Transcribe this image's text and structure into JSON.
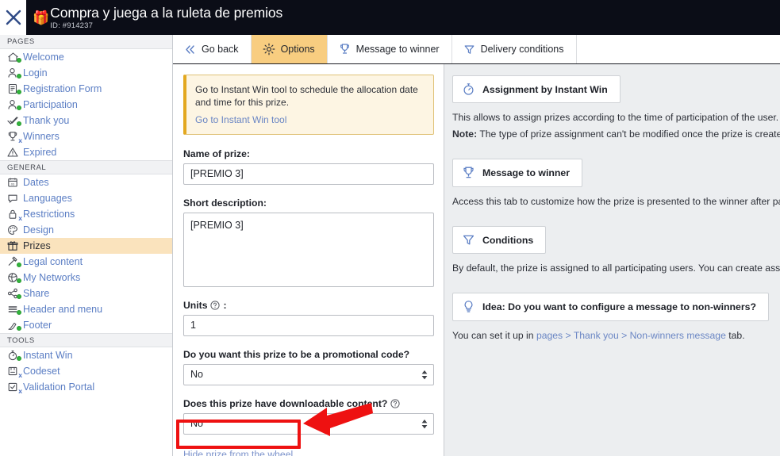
{
  "topbar": {
    "close_icon": "close-icon",
    "gift_icon": "🎁",
    "title": "Compra y juega a la ruleta de premios",
    "id": "ID: #914237"
  },
  "sidebar": {
    "sections": [
      {
        "label": "PAGES",
        "items": [
          {
            "label": "Welcome",
            "icon": "home-icon",
            "status": "on"
          },
          {
            "label": "Login",
            "icon": "user-icon",
            "status": "on"
          },
          {
            "label": "Registration Form",
            "icon": "form-icon",
            "status": "on"
          },
          {
            "label": "Participation",
            "icon": "user-check-icon",
            "status": "on"
          },
          {
            "label": "Thank you",
            "icon": "check-icon",
            "status": "on"
          },
          {
            "label": "Winners",
            "icon": "trophy-icon",
            "status": "off"
          },
          {
            "label": "Expired",
            "icon": "warning-icon",
            "status": "none"
          }
        ]
      },
      {
        "label": "GENERAL",
        "items": [
          {
            "label": "Dates",
            "icon": "calendar-icon",
            "status": "none"
          },
          {
            "label": "Languages",
            "icon": "speech-bubble-icon",
            "status": "none"
          },
          {
            "label": "Restrictions",
            "icon": "lock-icon",
            "status": "off"
          },
          {
            "label": "Design",
            "icon": "palette-icon",
            "status": "none"
          },
          {
            "label": "Prizes",
            "icon": "gift-icon",
            "status": "none",
            "active": true
          },
          {
            "label": "Legal content",
            "icon": "gavel-icon",
            "status": "on"
          },
          {
            "label": "My Networks",
            "icon": "network-icon",
            "status": "on"
          },
          {
            "label": "Share",
            "icon": "share-icon",
            "status": "on"
          },
          {
            "label": "Header and menu",
            "icon": "menu-icon",
            "status": "on"
          },
          {
            "label": "Footer",
            "icon": "footer-icon",
            "status": "on"
          }
        ]
      },
      {
        "label": "TOOLS",
        "items": [
          {
            "label": "Instant Win",
            "icon": "stopwatch-icon",
            "status": "on"
          },
          {
            "label": "Codeset",
            "icon": "codeset-icon",
            "status": "off"
          },
          {
            "label": "Validation Portal",
            "icon": "validation-icon",
            "status": "off"
          }
        ]
      }
    ]
  },
  "tabs": [
    {
      "label": "Go back",
      "icon": "chevron-double-left-icon",
      "active": false
    },
    {
      "label": "Options",
      "icon": "gear-icon",
      "active": true
    },
    {
      "label": "Message to winner",
      "icon": "trophy-icon",
      "active": false
    },
    {
      "label": "Delivery conditions",
      "icon": "funnel-icon",
      "active": false
    }
  ],
  "form": {
    "notice": {
      "text": "Go to Instant Win tool to schedule the allocation date and time for this prize.",
      "link": "Go to Instant Win tool"
    },
    "name_label": "Name of prize:",
    "name_value": "[PREMIO 3]",
    "description_label": "Short description:",
    "description_value": "[PREMIO 3]",
    "units_label": "Units",
    "units_suffix": ":",
    "units_value": "1",
    "promo_label": "Do you want this prize to be a promotional code?",
    "promo_value": "No",
    "downloadable_label": "Does this prize have downloadable content?",
    "downloadable_value": "No",
    "hide_link": "Hide prize from the wheel"
  },
  "info": {
    "card_assignment": "Assignment by Instant Win",
    "assignment_text": "This allows to assign prizes according to the time of participation of the user. The",
    "note_prefix": "Note:",
    "note_text": "The type of prize assignment can't be modified once the prize is created.",
    "card_message": "Message to winner",
    "message_text": "Access this tab to customize how the prize is presented to the winner after parti",
    "card_conditions": "Conditions",
    "conditions_text": "By default, the prize is assigned to all participating users. You can create assignm",
    "card_idea": "Idea: Do you want to configure a message to non-winners?",
    "idea_prefix": "You can set it up in ",
    "idea_link": "pages > Thank you > Non-winners message",
    "idea_suffix": " tab."
  },
  "colors": {
    "accent_amber": "#f8cd80",
    "sidebar_active": "#fae3bd",
    "link_blue": "#6a86c4",
    "annotation_red": "#ee1111",
    "status_green": "#31b43b"
  }
}
